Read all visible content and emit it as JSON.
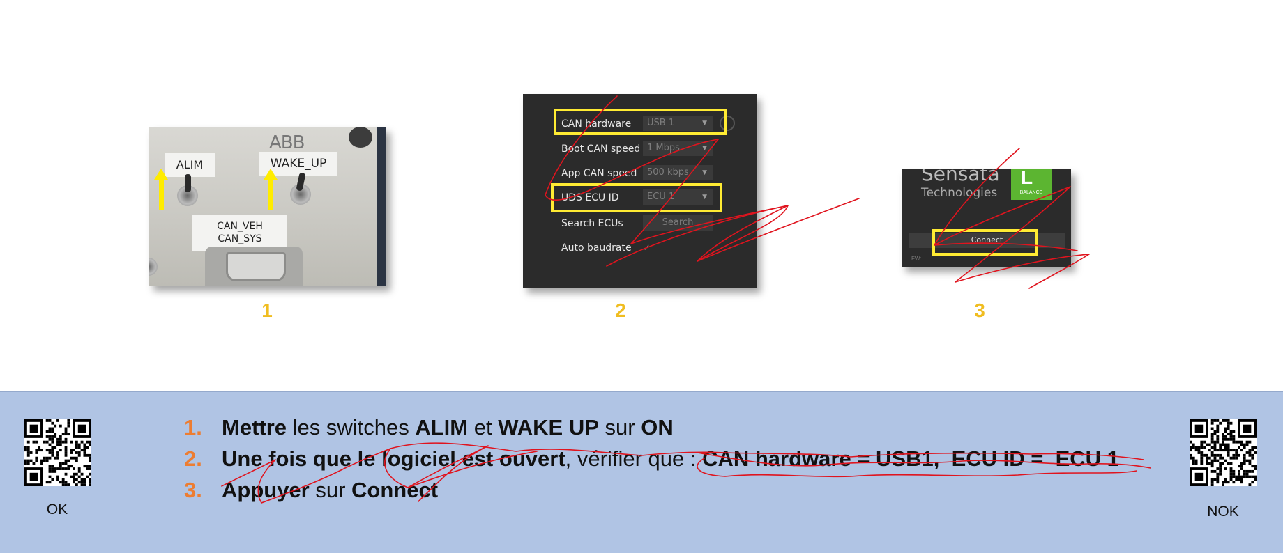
{
  "step1": {
    "number": "1",
    "photo": {
      "brand_text": "ABB",
      "label_alim": "ALIM",
      "label_wake_up": "WAKE_UP",
      "label_can": [
        "CAN_VEH",
        "CAN_SYS"
      ]
    }
  },
  "step2": {
    "number": "2",
    "rows": [
      {
        "label": "CAN hardware",
        "value": "USB 1",
        "dropdown": true
      },
      {
        "label": "Boot CAN speed",
        "value": "1 Mbps",
        "dropdown": true
      },
      {
        "label": "App CAN speed",
        "value": "500 kbps",
        "dropdown": true
      },
      {
        "label": "UDS ECU ID",
        "value": "ECU 1",
        "dropdown": true
      },
      {
        "label": "Search ECUs",
        "value": "Search",
        "dropdown": false
      },
      {
        "label": "Auto baudrate",
        "value": "✓",
        "dropdown": false
      }
    ],
    "highlight_color": "#ffeb33"
  },
  "step3": {
    "number": "3",
    "logo_name": "Sensata",
    "logo_sub": "Technologies",
    "tile_letter": "L",
    "tile_caption": "BALANCE",
    "connect_label": "Connect",
    "fw_label": "FW:"
  },
  "bottom": {
    "background": "#b0c4e4",
    "qr_left_caption": "OK",
    "qr_right_caption": "NOK",
    "instructions": [
      {
        "num": "1.",
        "parts": [
          {
            "text": "Mettre",
            "bold": true
          },
          {
            "text": " les switches ",
            "bold": false
          },
          {
            "text": "ALIM",
            "bold": true
          },
          {
            "text": " et ",
            "bold": false
          },
          {
            "text": "WAKE UP",
            "bold": true
          },
          {
            "text": " sur ",
            "bold": false
          },
          {
            "text": "ON",
            "bold": true
          }
        ]
      },
      {
        "num": "2.",
        "parts": [
          {
            "text": "Une fois que le logiciel est ouvert",
            "bold": true
          },
          {
            "text": ", vérifier que : ",
            "bold": false
          },
          {
            "text": "CAN hardware = USB1,  ECU ID =  ECU 1",
            "bold": true
          }
        ]
      },
      {
        "num": "3.",
        "parts": [
          {
            "text": "Appuyer",
            "bold": true
          },
          {
            "text": " sur ",
            "bold": false
          },
          {
            "text": "Connect",
            "bold": true
          }
        ]
      }
    ],
    "number_color": "#ed7d31"
  },
  "annotation_color": "#e0141e"
}
